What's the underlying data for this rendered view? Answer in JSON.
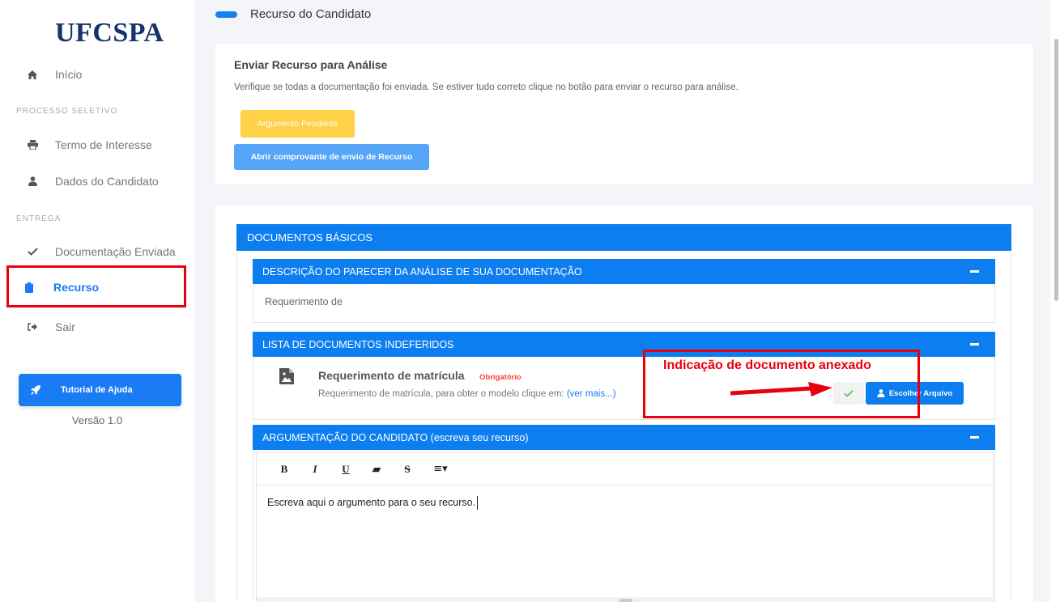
{
  "sidebar": {
    "logo": "UFCSPA",
    "items": [
      {
        "label": "Início",
        "icon": "home-icon"
      },
      {
        "label": "Termo de Interesse",
        "icon": "print-icon"
      },
      {
        "label": "Dados do Candidato",
        "icon": "user-icon"
      },
      {
        "label": "Documentação Enviada",
        "icon": "check-icon"
      },
      {
        "label": "Recurso",
        "icon": "clipboard-icon"
      },
      {
        "label": "Sair",
        "icon": "sign-out-icon"
      }
    ],
    "sections": [
      "PROCESSO SELETIVO",
      "ENTREGA"
    ],
    "help_button": "Tutorial de Ajuda",
    "version": "Versão 1.0"
  },
  "header": {
    "title": "Recurso do Candidato"
  },
  "send_card": {
    "title": "Enviar Recurso para Análise",
    "description": "Verifique se todas a documentação foi enviada. Se estiver tudo correto clique no botão para enviar o recurso para análise.",
    "pending_button": "Argumento Pendente",
    "receipt_button": "Abrir comprovante de envio de Recurso"
  },
  "documents": {
    "section_title": "DOCUMENTOS BÁSICOS",
    "opinion": {
      "title": "DESCRIÇÃO DO PARECER DA ANÁLISE DE SUA DOCUMENTAÇÃO",
      "text": "Requerimento de"
    },
    "rejected": {
      "title": "LISTA DE DOCUMENTOS INDEFERIDOS",
      "doc_title": "Requerimento de matrícula",
      "required_badge": "Obrigatório",
      "doc_desc": "Requerimento de matrícula, para obter o modelo clique em: ",
      "doc_link": "(ver mais...)",
      "file_button": "Escolher Arquivo"
    },
    "argument": {
      "title": "ARGUMENTAÇÃO DO CANDIDATO (escreva seu recurso)",
      "toolbar": [
        "B",
        "I",
        "U",
        "▰",
        "S",
        "≡▾"
      ],
      "text": "Escreva aqui o argumento para o seu recurso."
    }
  },
  "annotation": {
    "text": "Indicação de documento anexado"
  },
  "colors": {
    "primary": "#0d7ef0",
    "warning": "#ffd147",
    "annotation": "#e8000f",
    "required": "#f44336"
  }
}
